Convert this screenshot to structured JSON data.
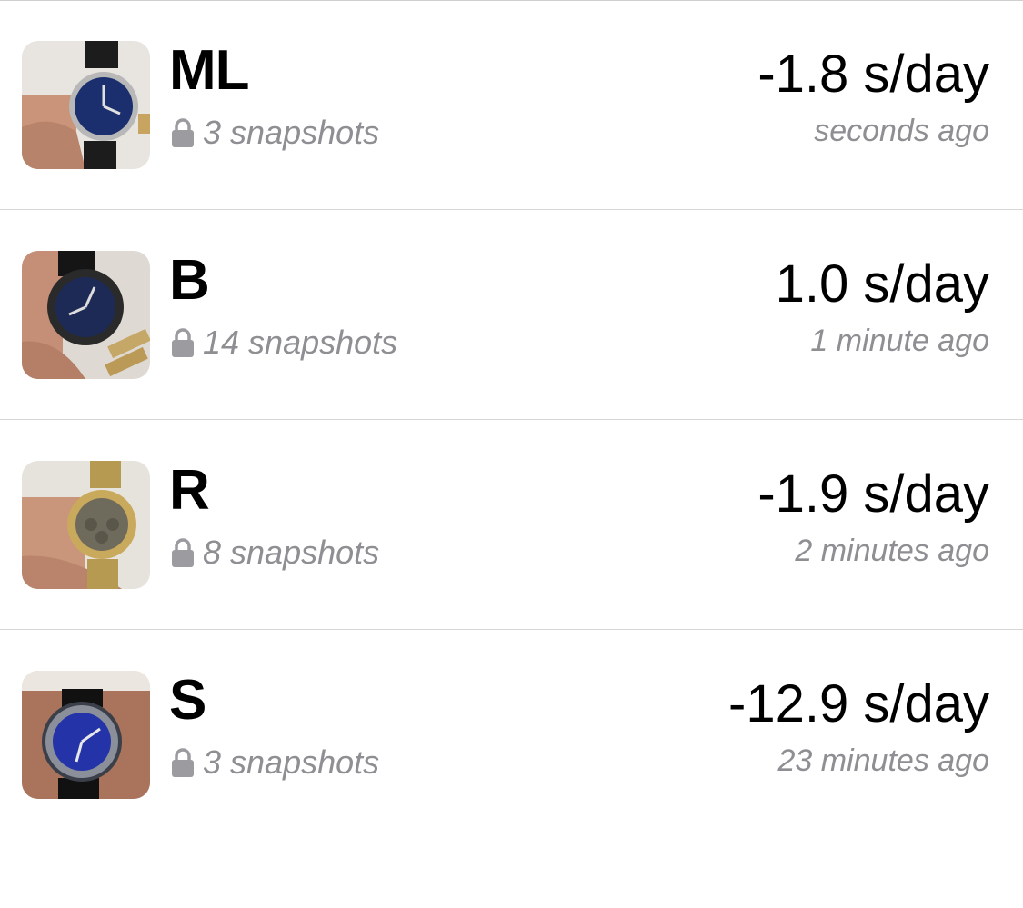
{
  "watches": [
    {
      "name": "ML",
      "snapshots": "3 snapshots",
      "rate": "-1.8 s/day",
      "updated": "seconds ago",
      "thumb_icon": "watch-photo",
      "dial_color": "#1b2f6e",
      "strap_color": "#1c1c1c",
      "case_color": "#b8b8b8"
    },
    {
      "name": "B",
      "snapshots": "14 snapshots",
      "rate": "1.0 s/day",
      "updated": "1 minute ago",
      "thumb_icon": "watch-photo",
      "dial_color": "#1d2a55",
      "strap_color": "#151515",
      "case_color": "#2a2a2a"
    },
    {
      "name": "R",
      "snapshots": "8 snapshots",
      "rate": "-1.9 s/day",
      "updated": "2 minutes ago",
      "thumb_icon": "watch-photo",
      "dial_color": "#6e6a5c",
      "strap_color": "#b79a52",
      "case_color": "#c9a95c"
    },
    {
      "name": "S",
      "snapshots": "3 snapshots",
      "rate": "-12.9 s/day",
      "updated": "23 minutes ago",
      "thumb_icon": "watch-photo",
      "dial_color": "#2433a8",
      "strap_color": "#111111",
      "case_color": "#8a8f99"
    }
  ],
  "colors": {
    "primary_text": "#000000",
    "secondary_text": "#8e8e93",
    "separator": "#d6d6d6",
    "lock_icon": "#9b9ba0"
  }
}
